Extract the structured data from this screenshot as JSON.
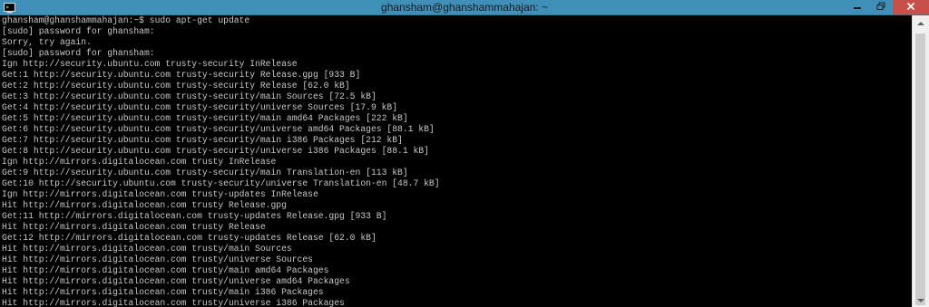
{
  "window": {
    "title": "ghansham@ghanshammahajan: ~",
    "icon": "putty-terminal-icon",
    "controls": [
      "minimize-icon",
      "restore-icon",
      "close-icon"
    ],
    "colors": {
      "titlebar": "#3f8fb8",
      "close": "#c7504a",
      "background": "#000000",
      "text": "#c8c8c8"
    }
  },
  "terminal": {
    "lines": [
      "ghansham@ghanshammahajan:~$ sudo apt-get update",
      "[sudo] password for ghansham:",
      "Sorry, try again.",
      "[sudo] password for ghansham:",
      "Ign http://security.ubuntu.com trusty-security InRelease",
      "Get:1 http://security.ubuntu.com trusty-security Release.gpg [933 B]",
      "Get:2 http://security.ubuntu.com trusty-security Release [62.0 kB]",
      "Get:3 http://security.ubuntu.com trusty-security/main Sources [72.5 kB]",
      "Get:4 http://security.ubuntu.com trusty-security/universe Sources [17.9 kB]",
      "Get:5 http://security.ubuntu.com trusty-security/main amd64 Packages [222 kB]",
      "Get:6 http://security.ubuntu.com trusty-security/universe amd64 Packages [88.1 kB]",
      "Get:7 http://security.ubuntu.com trusty-security/main i386 Packages [212 kB]",
      "Get:8 http://security.ubuntu.com trusty-security/universe i386 Packages [88.1 kB]",
      "Ign http://mirrors.digitalocean.com trusty InRelease",
      "Get:9 http://security.ubuntu.com trusty-security/main Translation-en [113 kB]",
      "Get:10 http://security.ubuntu.com trusty-security/universe Translation-en [48.7 kB]",
      "Ign http://mirrors.digitalocean.com trusty-updates InRelease",
      "Hit http://mirrors.digitalocean.com trusty Release.gpg",
      "Get:11 http://mirrors.digitalocean.com trusty-updates Release.gpg [933 B]",
      "Hit http://mirrors.digitalocean.com trusty Release",
      "Get:12 http://mirrors.digitalocean.com trusty-updates Release [62.0 kB]",
      "Hit http://mirrors.digitalocean.com trusty/main Sources",
      "Hit http://mirrors.digitalocean.com trusty/universe Sources",
      "Hit http://mirrors.digitalocean.com trusty/main amd64 Packages",
      "Hit http://mirrors.digitalocean.com trusty/universe amd64 Packages",
      "Hit http://mirrors.digitalocean.com trusty/main i386 Packages",
      "Hit http://mirrors.digitalocean.com trusty/universe i386 Packages"
    ]
  },
  "scrollbar": {
    "up_icon": "scroll-up-arrow-icon",
    "down_icon": "scroll-down-arrow-icon"
  }
}
